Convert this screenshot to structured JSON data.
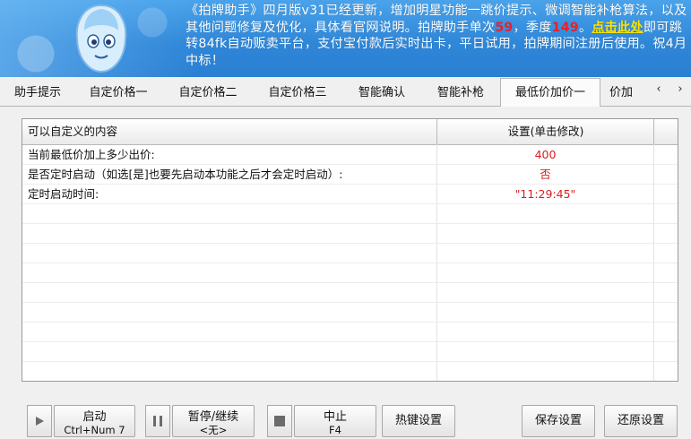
{
  "banner": {
    "brand": "《拍牌助手》",
    "line1": "四月版v31已经更新，增加明星功能一跳价提示、微调智能补枪算法，以及其他问题修复及优化，具体看官网说明。拍牌助手单次",
    "single_count": "59",
    "season_prefix": "，季度",
    "season_count": "149",
    "dot": "。",
    "link": "点击此处",
    "line2": "即可跳转84fk自动贩卖平台，支付宝付款后实时出卡，平日试用，拍牌期间注册后使用。祝4月中标！"
  },
  "tabs": [
    {
      "label": "助手提示"
    },
    {
      "label": "自定价格一"
    },
    {
      "label": "自定价格二"
    },
    {
      "label": "自定价格三"
    },
    {
      "label": "智能确认"
    },
    {
      "label": "智能补枪"
    },
    {
      "label": "最低价加价一"
    },
    {
      "label": "价加"
    }
  ],
  "active_tab": "最低价加价一",
  "tab_scroll": {
    "left": "‹",
    "right": "›"
  },
  "table": {
    "col1": "可以自定义的内容",
    "col2": "设置(单击修改)",
    "rows": [
      {
        "label": "当前最低价加上多少出价:",
        "value": "400"
      },
      {
        "label": "是否定时启动（如选[是]也要先启动本功能之后才会定时启动）:",
        "value": "否"
      },
      {
        "label": "定时启动时间:",
        "value": "\"11:29:45\""
      }
    ]
  },
  "buttons": {
    "start": {
      "label": "启动",
      "sub": "Ctrl+Num 7"
    },
    "pause": {
      "label": "暂停/继续",
      "sub": "<无>"
    },
    "stop": {
      "label": "中止",
      "sub": "F4"
    },
    "hotkey": "热键设置",
    "save": "保存设置",
    "restore": "还原设置"
  },
  "icons": {
    "play": "play-icon",
    "pause": "pause-icon",
    "stop": "stop-icon"
  },
  "colors": {
    "banner": "#2f87d8",
    "highlight": "#e8202c",
    "link": "#ffe300",
    "value": "#d81e1e"
  }
}
